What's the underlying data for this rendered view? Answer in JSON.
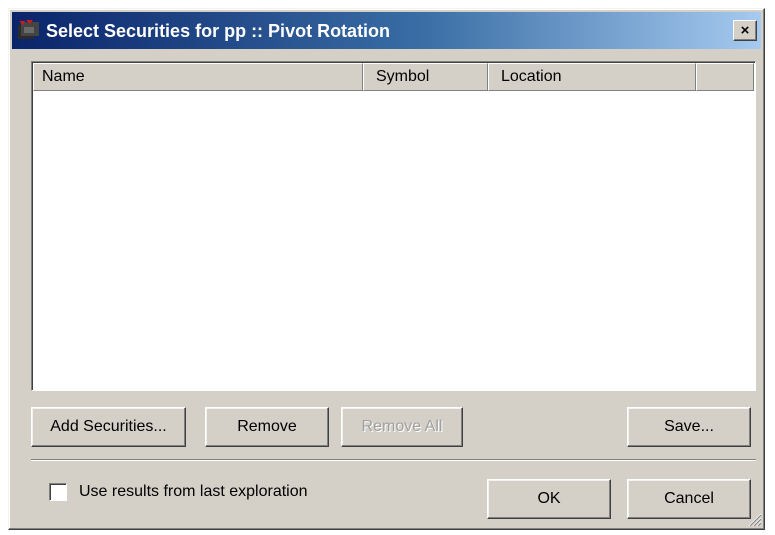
{
  "window": {
    "title": "Select Securities for pp :: Pivot Rotation",
    "close_glyph": "×",
    "icon": "app-logo-icon"
  },
  "list": {
    "columns": [
      "Name",
      "Symbol",
      "Location",
      ""
    ],
    "rows": []
  },
  "buttons": {
    "add_securities": "Add Securities...",
    "remove": "Remove",
    "remove_all": "Remove All",
    "save": "Save...",
    "ok": "OK",
    "cancel": "Cancel"
  },
  "options": {
    "use_last_results_label": "Use results from last exploration",
    "use_last_results_checked": false
  },
  "colors": {
    "titlebar_start": "#0a246a",
    "titlebar_end": "#a6caf0",
    "face": "#d4d0c8"
  }
}
